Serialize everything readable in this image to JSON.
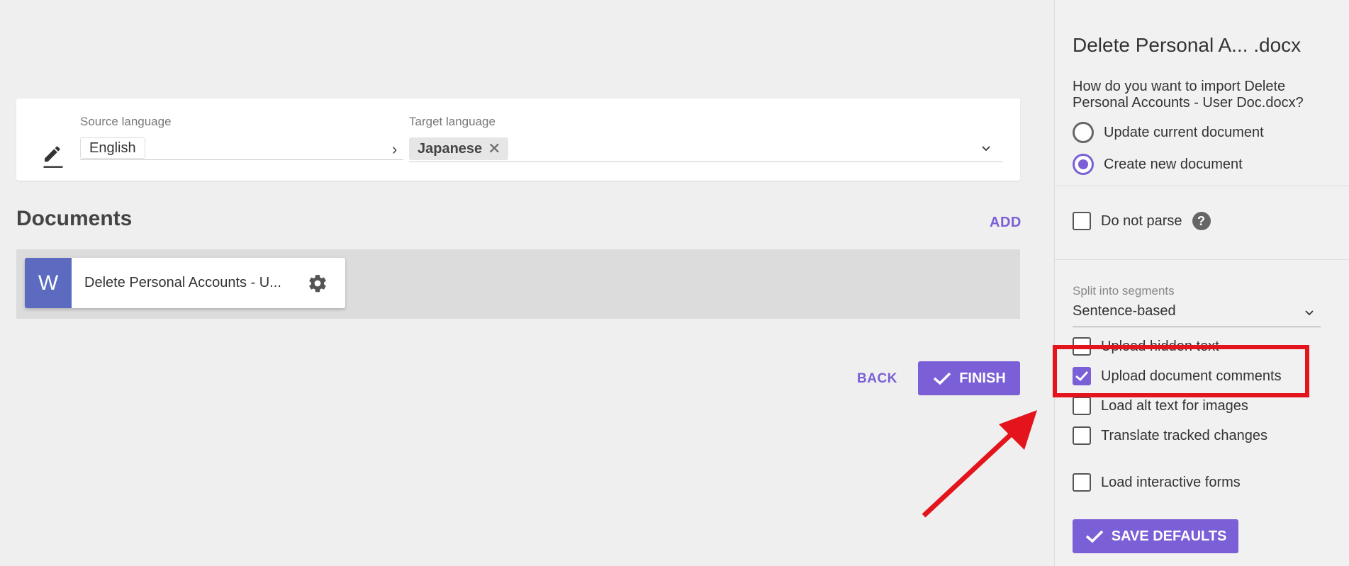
{
  "languages": {
    "source_label": "Source language",
    "source_value": "English",
    "target_label": "Target language",
    "target_value": "Japanese"
  },
  "documents": {
    "title": "Documents",
    "add_label": "ADD",
    "items": [
      {
        "badge": "W",
        "name": "Delete Personal Accounts - U..."
      }
    ]
  },
  "actions": {
    "back_label": "BACK",
    "finish_label": "FINISH"
  },
  "panel": {
    "title": "Delete Personal A... .docx",
    "question": "How do you want to import Delete Personal Accounts - User Doc.docx?",
    "radios": [
      {
        "label": "Update current document",
        "selected": false
      },
      {
        "label": "Create new document",
        "selected": true
      }
    ],
    "do_not_parse": {
      "label": "Do not parse",
      "checked": false,
      "help": "?"
    },
    "split": {
      "label": "Split into segments",
      "value": "Sentence-based"
    },
    "options": [
      {
        "label": "Upload hidden text",
        "checked": false
      },
      {
        "label": "Upload document comments",
        "checked": true
      },
      {
        "label": "Load alt text for images",
        "checked": false
      },
      {
        "label": "Translate tracked changes",
        "checked": false
      },
      {
        "label": "Load interactive forms",
        "checked": false
      }
    ],
    "save_defaults_label": "SAVE DEFAULTS"
  },
  "colors": {
    "accent": "#7b5fd6",
    "word_badge": "#5c6bc0",
    "annotation": "#e3141c"
  }
}
